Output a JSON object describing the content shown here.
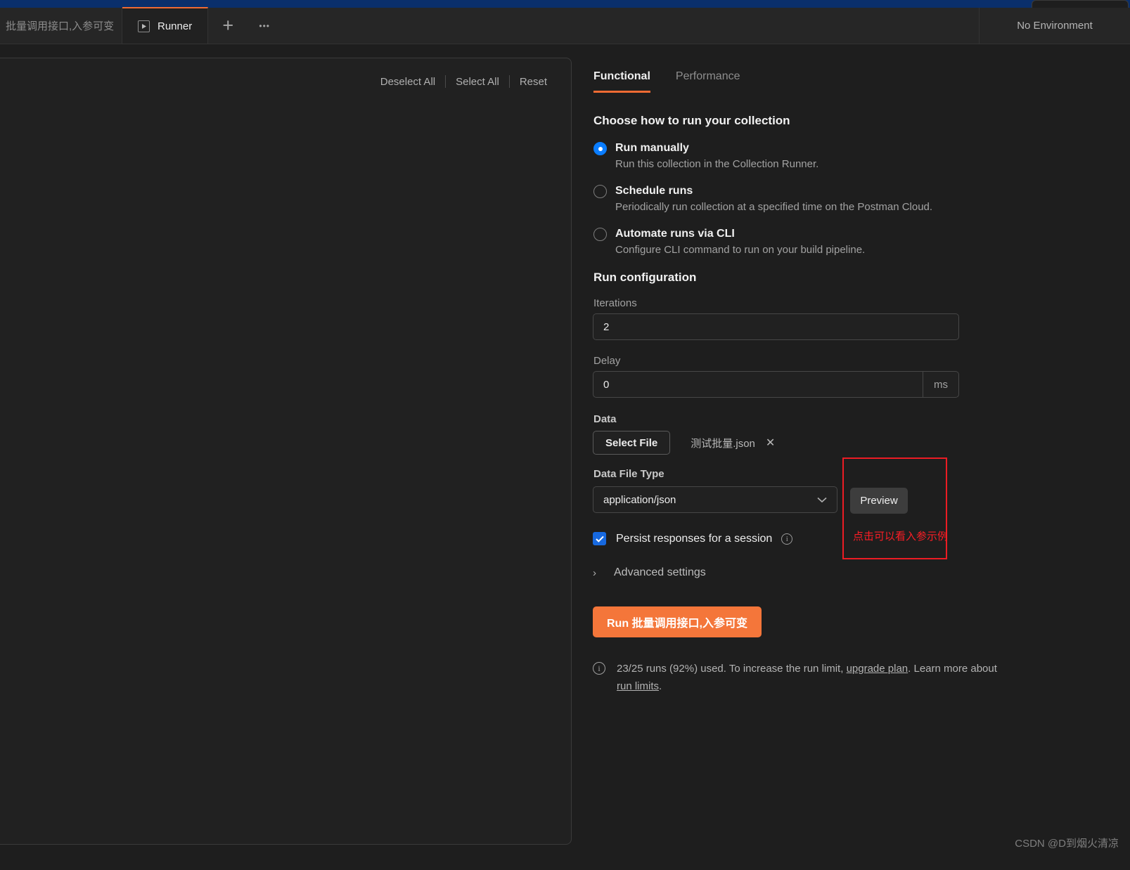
{
  "window": {
    "accent_orange": "#ef6b33",
    "annotation_red": "#ec1c24",
    "titlebar_blue": "#0a2f6b"
  },
  "tabbar": {
    "inactive_tab_label": "批量调用接口,入参可变",
    "active_tab_label": "Runner",
    "play_icon": "play-icon",
    "new_tab_icon": "+",
    "more_icon": "•••",
    "environment_selector": "No Environment"
  },
  "left_panel": {
    "actions": [
      {
        "label": "Deselect All"
      },
      {
        "label": "Select All"
      },
      {
        "label": "Reset"
      }
    ]
  },
  "right_pane": {
    "tabs": [
      {
        "label": "Functional",
        "active": true
      },
      {
        "label": "Performance",
        "active": false
      }
    ],
    "choose": {
      "title": "Choose how to run your collection",
      "options": [
        {
          "label": "Run manually",
          "description": "Run this collection in the Collection Runner.",
          "selected": true
        },
        {
          "label": "Schedule runs",
          "description": "Periodically run collection at a specified time on the Postman Cloud.",
          "selected": false
        },
        {
          "label": "Automate runs via CLI",
          "description": "Configure CLI command to run on your build pipeline.",
          "selected": false
        }
      ]
    },
    "run_configuration": {
      "title": "Run configuration",
      "iterations": {
        "label": "Iterations",
        "value": "2"
      },
      "delay": {
        "label": "Delay",
        "value": "0",
        "unit": "ms"
      },
      "data": {
        "label": "Data",
        "select_file_button": "Select File",
        "file_name": "测试批量.json",
        "remove_icon": "✕"
      },
      "data_file_type": {
        "label": "Data File Type",
        "value": "application/json",
        "chevron_icon": "chevron-down-icon"
      },
      "persist": {
        "label": "Persist responses for a session",
        "checked": true,
        "info_icon": "i"
      },
      "advanced_settings": {
        "label": "Advanced settings",
        "chevron_icon": "›"
      },
      "run_button": "Run 批量调用接口,入参可变",
      "runs_note": {
        "info_icon": "i",
        "part1": "23/25 runs (92%) used. To increase the run limit, ",
        "link1": "upgrade plan",
        "part2": ". Learn more about ",
        "link2": "run limits",
        "part3": "."
      }
    }
  },
  "annotation": {
    "preview_button": "Preview",
    "note_text": "点击可以看入参示例"
  },
  "watermark": "CSDN @D到烟火清凉"
}
